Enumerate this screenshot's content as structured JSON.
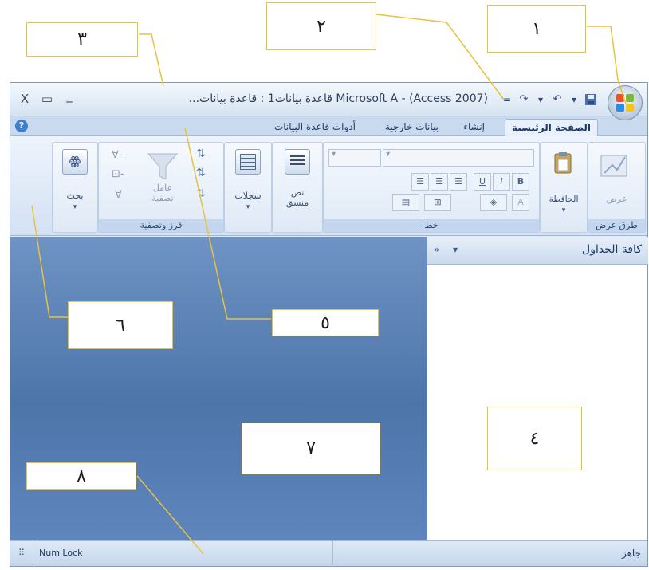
{
  "window": {
    "title": "Microsoft A - (Access 2007) قاعدة بيانات1 : قاعدة بيانات...",
    "minimize_glyph": "_",
    "restore_glyph": "▭",
    "close_glyph": "X"
  },
  "qat": {
    "save_icon": "save-icon",
    "undo_glyph": "↶",
    "redo_glyph": "↷",
    "dropdown_glyph": "▾",
    "customize_glyph": "="
  },
  "tabs": [
    {
      "label": "الصفحة الرئيسية",
      "active": true
    },
    {
      "label": "إنشاء",
      "active": false
    },
    {
      "label": "بيانات خارجية",
      "active": false
    },
    {
      "label": "أدوات قاعدة البيانات",
      "active": false
    }
  ],
  "help_glyph": "?",
  "ribbon": {
    "views_group": {
      "label": "طرق عرض",
      "button": "عرض"
    },
    "clipboard_group": {
      "button": "الحافظة"
    },
    "font_group": {
      "label": "خط",
      "bold": "B",
      "italic": "I",
      "underline": "U",
      "font_color": "A"
    },
    "rich_text_group": {
      "button": "نص منسق"
    },
    "records_group": {
      "button": "سجلات"
    },
    "sort_filter_group": {
      "label": "فرز وتصفية",
      "filter_button": "عامل تصفية"
    },
    "find_group": {
      "button": "بحث"
    }
  },
  "nav_pane": {
    "title": "كافة الجداول",
    "menu_glyph": "▾",
    "collapse_glyph": "»"
  },
  "status_bar": {
    "left_text": "جاهز",
    "right_text": "Num Lock"
  },
  "callouts": [
    {
      "id": "1",
      "text": "١"
    },
    {
      "id": "2",
      "text": "٢"
    },
    {
      "id": "3",
      "text": "٣"
    },
    {
      "id": "4",
      "text": "٤"
    },
    {
      "id": "5",
      "text": "٥"
    },
    {
      "id": "6",
      "text": "٦"
    },
    {
      "id": "7",
      "text": "٧"
    },
    {
      "id": "8",
      "text": "٨"
    }
  ],
  "colors": {
    "callout_border": "#e8c23c",
    "workspace": "#5a80b6",
    "ribbon": "#dfe9f5"
  }
}
